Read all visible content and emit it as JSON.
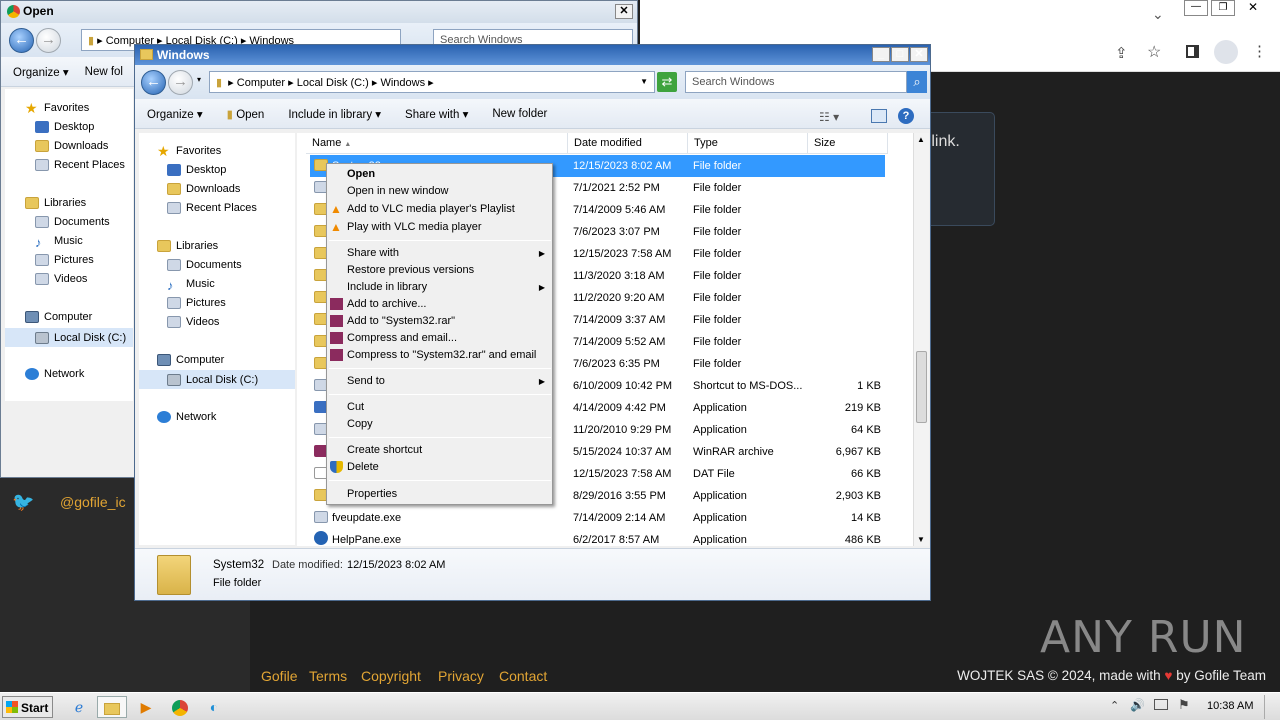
{
  "browser": {
    "notice_text": "d link.",
    "twitter_handle": "@gofile_ic",
    "footer_links": [
      "Gofile",
      "Terms",
      "Copyright",
      "Privacy",
      "Contact"
    ],
    "credit_prefix": "WOJTEK SAS © 2024, made with",
    "credit_suffix": "by Gofile Team",
    "watermark": "ANY RUN",
    "heart_color": "#e53935",
    "link_color": "#e2a534"
  },
  "open_dialog": {
    "title": "Open",
    "address": [
      "Computer",
      "Local Disk (C:)",
      "Windows"
    ],
    "search_placeholder": "Search Windows",
    "toolbar": {
      "organize": "Organize",
      "new_folder": "New fol"
    },
    "nav": {
      "favorites": "Favorites",
      "desktop": "Desktop",
      "downloads": "Downloads",
      "recent": "Recent Places",
      "libraries": "Libraries",
      "documents": "Documents",
      "music": "Music",
      "pictures": "Pictures",
      "videos": "Videos",
      "computer": "Computer",
      "local_disk": "Local Disk (C:)",
      "network": "Network"
    }
  },
  "explorer": {
    "title": "Windows",
    "address": [
      "Computer",
      "Local Disk (C:)",
      "Windows"
    ],
    "search_placeholder": "Search Windows",
    "toolbar": {
      "organize": "Organize",
      "open": "Open",
      "include_in_library": "Include in library",
      "share_with": "Share with",
      "new_folder": "New folder"
    },
    "nav": {
      "favorites": "Favorites",
      "desktop": "Desktop",
      "downloads": "Downloads",
      "recent": "Recent Places",
      "libraries": "Libraries",
      "documents": "Documents",
      "music": "Music",
      "pictures": "Pictures",
      "videos": "Videos",
      "computer": "Computer",
      "local_disk": "Local Disk (C:)",
      "network": "Network"
    },
    "columns": {
      "name": "Name",
      "date": "Date modified",
      "type": "Type",
      "size": "Size"
    },
    "rows": [
      {
        "name": "System32",
        "date": "12/15/2023 8:02 AM",
        "type": "File folder",
        "size": ""
      },
      {
        "name": "",
        "date": "7/1/2021 2:52 PM",
        "type": "File folder",
        "size": ""
      },
      {
        "name": "",
        "date": "7/14/2009 5:46 AM",
        "type": "File folder",
        "size": ""
      },
      {
        "name": "",
        "date": "7/6/2023 3:07 PM",
        "type": "File folder",
        "size": ""
      },
      {
        "name": "",
        "date": "12/15/2023 7:58 AM",
        "type": "File folder",
        "size": ""
      },
      {
        "name": "",
        "date": "11/3/2020 3:18 AM",
        "type": "File folder",
        "size": ""
      },
      {
        "name": "",
        "date": "11/2/2020 9:20 AM",
        "type": "File folder",
        "size": ""
      },
      {
        "name": "",
        "date": "7/14/2009 3:37 AM",
        "type": "File folder",
        "size": ""
      },
      {
        "name": "",
        "date": "7/14/2009 5:52 AM",
        "type": "File folder",
        "size": ""
      },
      {
        "name": "",
        "date": "7/6/2023 6:35 PM",
        "type": "File folder",
        "size": ""
      },
      {
        "name": "",
        "date": "6/10/2009 10:42 PM",
        "type": "Shortcut to MS-DOS...",
        "size": "1 KB"
      },
      {
        "name": "",
        "date": "4/14/2009 4:42 PM",
        "type": "Application",
        "size": "219 KB"
      },
      {
        "name": "",
        "date": "11/20/2010 9:29 PM",
        "type": "Application",
        "size": "64 KB"
      },
      {
        "name": "",
        "date": "5/15/2024 10:37 AM",
        "type": "WinRAR archive",
        "size": "6,967 KB"
      },
      {
        "name": "",
        "date": "12/15/2023 7:58 AM",
        "type": "DAT File",
        "size": "66 KB"
      },
      {
        "name": "",
        "date": "8/29/2016 3:55 PM",
        "type": "Application",
        "size": "2,903 KB"
      },
      {
        "name": "fveupdate.exe",
        "date": "7/14/2009 2:14 AM",
        "type": "Application",
        "size": "14 KB"
      },
      {
        "name": "HelpPane.exe",
        "date": "6/2/2017 8:57 AM",
        "type": "Application",
        "size": "486 KB"
      }
    ],
    "details": {
      "name": "System32",
      "date_label": "Date modified:",
      "date": "12/15/2023 8:02 AM",
      "type": "File folder"
    }
  },
  "context_menu": {
    "open": "Open",
    "open_new_window": "Open in new window",
    "vlc_playlist": "Add to VLC media player's Playlist",
    "vlc_play": "Play with VLC media player",
    "share_with": "Share with",
    "restore": "Restore previous versions",
    "include_library": "Include in library",
    "add_archive": "Add to archive...",
    "add_rar": "Add to \"System32.rar\"",
    "compress_email": "Compress and email...",
    "compress_rar_email": "Compress to \"System32.rar\" and email",
    "send_to": "Send to",
    "cut": "Cut",
    "copy": "Copy",
    "create_shortcut": "Create shortcut",
    "delete": "Delete",
    "properties": "Properties"
  },
  "taskbar": {
    "start": "Start",
    "clock": "10:38 AM"
  }
}
